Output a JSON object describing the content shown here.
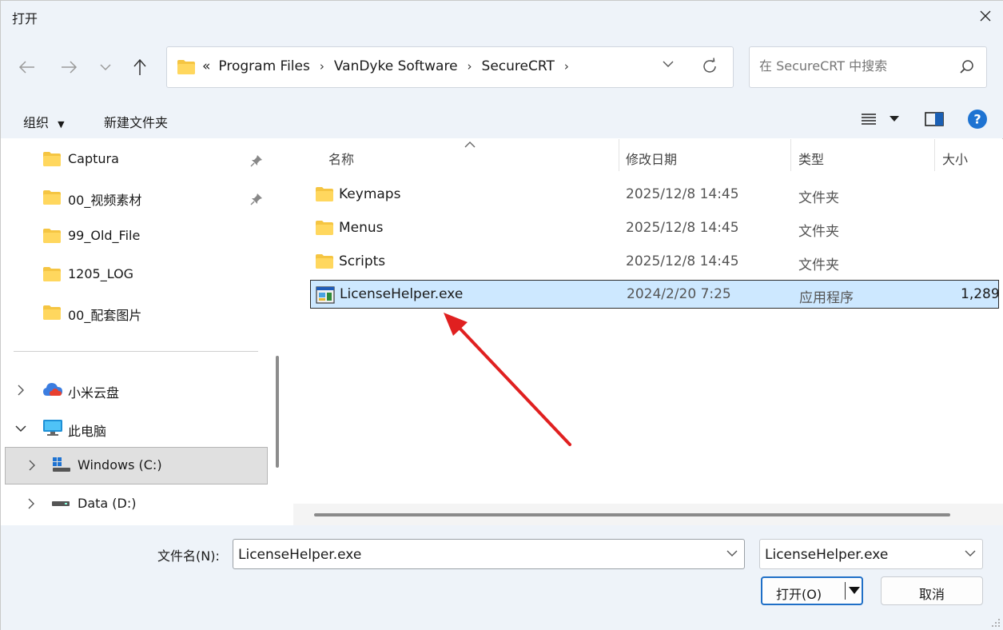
{
  "window": {
    "title": "打开"
  },
  "address": {
    "overflow": "«",
    "crumbs": [
      "Program Files",
      "VanDyke Software",
      "SecureCRT"
    ]
  },
  "search": {
    "placeholder": "在 SecureCRT 中搜索"
  },
  "toolbar": {
    "organize": "组织",
    "new_folder": "新建文件夹"
  },
  "quick_access": [
    {
      "label": "Captura",
      "pinned": true
    },
    {
      "label": "00_视频素材",
      "pinned": true
    },
    {
      "label": "99_Old_File",
      "pinned": false
    },
    {
      "label": "1205_LOG",
      "pinned": false
    },
    {
      "label": "00_配套图片",
      "pinned": false
    }
  ],
  "tree": {
    "cloud": "小米云盘",
    "this_pc": "此电脑",
    "drive_c": "Windows (C:)",
    "drive_d": "Data (D:)"
  },
  "columns": {
    "name": "名称",
    "modified": "修改日期",
    "type": "类型",
    "size": "大小"
  },
  "files": [
    {
      "name": "Keymaps",
      "modified": "2025/12/8 14:45",
      "type": "文件夹",
      "size": ""
    },
    {
      "name": "Menus",
      "modified": "2025/12/8 14:45",
      "type": "文件夹",
      "size": ""
    },
    {
      "name": "Scripts",
      "modified": "2025/12/8 14:45",
      "type": "文件夹",
      "size": ""
    },
    {
      "name": "LicenseHelper.exe",
      "modified": "2024/2/20 7:25",
      "type": "应用程序",
      "size": "1,289",
      "selected": true
    }
  ],
  "bottom": {
    "filename_label": "文件名(N):",
    "filename_value": "LicenseHelper.exe",
    "filter_value": "LicenseHelper.exe",
    "open_label": "打开(O)",
    "cancel_label": "取消"
  },
  "colors": {
    "accent": "#1f6fc7",
    "selection": "#cde8ff",
    "annotation_arrow": "#e02020",
    "folder": "#f5c542"
  }
}
